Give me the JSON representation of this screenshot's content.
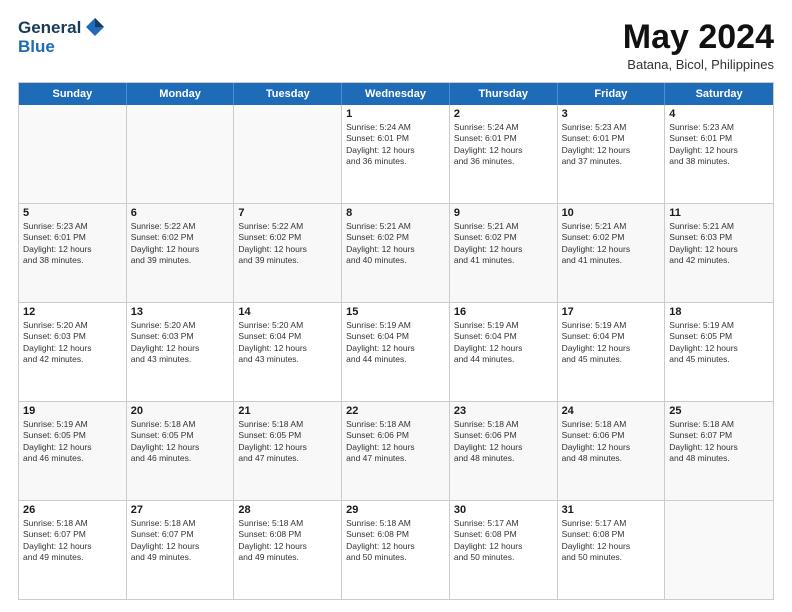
{
  "logo": {
    "line1": "General",
    "line2": "Blue"
  },
  "title": "May 2024",
  "location": "Batana, Bicol, Philippines",
  "days_header": [
    "Sunday",
    "Monday",
    "Tuesday",
    "Wednesday",
    "Thursday",
    "Friday",
    "Saturday"
  ],
  "weeks": [
    [
      {
        "day": "",
        "info": ""
      },
      {
        "day": "",
        "info": ""
      },
      {
        "day": "",
        "info": ""
      },
      {
        "day": "1",
        "info": "Sunrise: 5:24 AM\nSunset: 6:01 PM\nDaylight: 12 hours\nand 36 minutes."
      },
      {
        "day": "2",
        "info": "Sunrise: 5:24 AM\nSunset: 6:01 PM\nDaylight: 12 hours\nand 36 minutes."
      },
      {
        "day": "3",
        "info": "Sunrise: 5:23 AM\nSunset: 6:01 PM\nDaylight: 12 hours\nand 37 minutes."
      },
      {
        "day": "4",
        "info": "Sunrise: 5:23 AM\nSunset: 6:01 PM\nDaylight: 12 hours\nand 38 minutes."
      }
    ],
    [
      {
        "day": "5",
        "info": "Sunrise: 5:23 AM\nSunset: 6:01 PM\nDaylight: 12 hours\nand 38 minutes."
      },
      {
        "day": "6",
        "info": "Sunrise: 5:22 AM\nSunset: 6:02 PM\nDaylight: 12 hours\nand 39 minutes."
      },
      {
        "day": "7",
        "info": "Sunrise: 5:22 AM\nSunset: 6:02 PM\nDaylight: 12 hours\nand 39 minutes."
      },
      {
        "day": "8",
        "info": "Sunrise: 5:21 AM\nSunset: 6:02 PM\nDaylight: 12 hours\nand 40 minutes."
      },
      {
        "day": "9",
        "info": "Sunrise: 5:21 AM\nSunset: 6:02 PM\nDaylight: 12 hours\nand 41 minutes."
      },
      {
        "day": "10",
        "info": "Sunrise: 5:21 AM\nSunset: 6:02 PM\nDaylight: 12 hours\nand 41 minutes."
      },
      {
        "day": "11",
        "info": "Sunrise: 5:21 AM\nSunset: 6:03 PM\nDaylight: 12 hours\nand 42 minutes."
      }
    ],
    [
      {
        "day": "12",
        "info": "Sunrise: 5:20 AM\nSunset: 6:03 PM\nDaylight: 12 hours\nand 42 minutes."
      },
      {
        "day": "13",
        "info": "Sunrise: 5:20 AM\nSunset: 6:03 PM\nDaylight: 12 hours\nand 43 minutes."
      },
      {
        "day": "14",
        "info": "Sunrise: 5:20 AM\nSunset: 6:04 PM\nDaylight: 12 hours\nand 43 minutes."
      },
      {
        "day": "15",
        "info": "Sunrise: 5:19 AM\nSunset: 6:04 PM\nDaylight: 12 hours\nand 44 minutes."
      },
      {
        "day": "16",
        "info": "Sunrise: 5:19 AM\nSunset: 6:04 PM\nDaylight: 12 hours\nand 44 minutes."
      },
      {
        "day": "17",
        "info": "Sunrise: 5:19 AM\nSunset: 6:04 PM\nDaylight: 12 hours\nand 45 minutes."
      },
      {
        "day": "18",
        "info": "Sunrise: 5:19 AM\nSunset: 6:05 PM\nDaylight: 12 hours\nand 45 minutes."
      }
    ],
    [
      {
        "day": "19",
        "info": "Sunrise: 5:19 AM\nSunset: 6:05 PM\nDaylight: 12 hours\nand 46 minutes."
      },
      {
        "day": "20",
        "info": "Sunrise: 5:18 AM\nSunset: 6:05 PM\nDaylight: 12 hours\nand 46 minutes."
      },
      {
        "day": "21",
        "info": "Sunrise: 5:18 AM\nSunset: 6:05 PM\nDaylight: 12 hours\nand 47 minutes."
      },
      {
        "day": "22",
        "info": "Sunrise: 5:18 AM\nSunset: 6:06 PM\nDaylight: 12 hours\nand 47 minutes."
      },
      {
        "day": "23",
        "info": "Sunrise: 5:18 AM\nSunset: 6:06 PM\nDaylight: 12 hours\nand 48 minutes."
      },
      {
        "day": "24",
        "info": "Sunrise: 5:18 AM\nSunset: 6:06 PM\nDaylight: 12 hours\nand 48 minutes."
      },
      {
        "day": "25",
        "info": "Sunrise: 5:18 AM\nSunset: 6:07 PM\nDaylight: 12 hours\nand 48 minutes."
      }
    ],
    [
      {
        "day": "26",
        "info": "Sunrise: 5:18 AM\nSunset: 6:07 PM\nDaylight: 12 hours\nand 49 minutes."
      },
      {
        "day": "27",
        "info": "Sunrise: 5:18 AM\nSunset: 6:07 PM\nDaylight: 12 hours\nand 49 minutes."
      },
      {
        "day": "28",
        "info": "Sunrise: 5:18 AM\nSunset: 6:08 PM\nDaylight: 12 hours\nand 49 minutes."
      },
      {
        "day": "29",
        "info": "Sunrise: 5:18 AM\nSunset: 6:08 PM\nDaylight: 12 hours\nand 50 minutes."
      },
      {
        "day": "30",
        "info": "Sunrise: 5:17 AM\nSunset: 6:08 PM\nDaylight: 12 hours\nand 50 minutes."
      },
      {
        "day": "31",
        "info": "Sunrise: 5:17 AM\nSunset: 6:08 PM\nDaylight: 12 hours\nand 50 minutes."
      },
      {
        "day": "",
        "info": ""
      }
    ]
  ]
}
